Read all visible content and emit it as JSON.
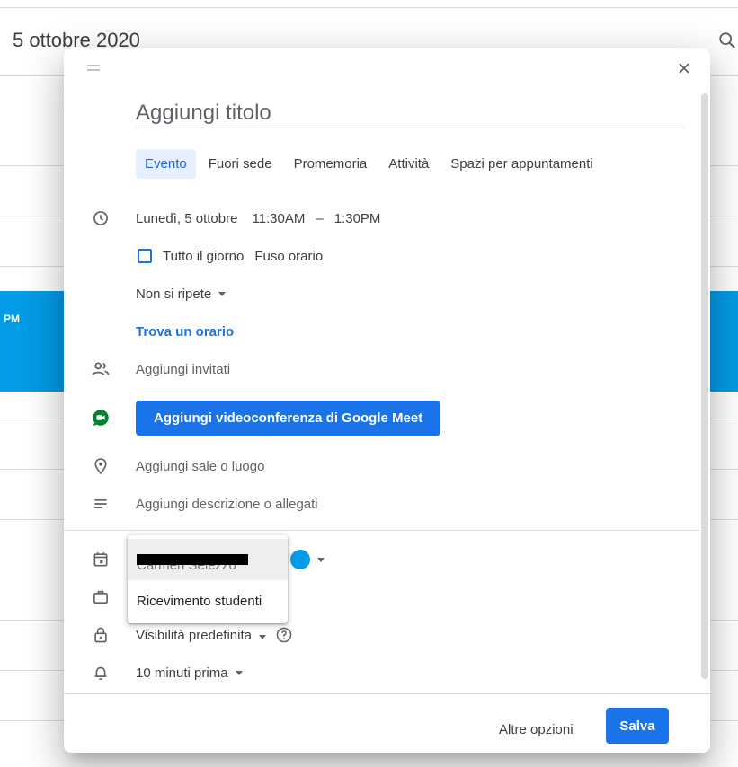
{
  "background": {
    "date_title": "5 ottobre 2020",
    "event_fragment": "PM"
  },
  "dialog": {
    "title_placeholder": "Aggiungi titolo",
    "tabs": [
      {
        "label": "Evento",
        "active": true
      },
      {
        "label": "Fuori sede",
        "active": false
      },
      {
        "label": "Promemoria",
        "active": false
      },
      {
        "label": "Attività",
        "active": false
      },
      {
        "label": "Spazi per appuntamenti",
        "active": false
      }
    ],
    "datetime": {
      "date": "Lunedì, 5 ottobre",
      "start": "11:30AM",
      "separator": "–",
      "end": "1:30PM"
    },
    "all_day_label": "Tutto il giorno",
    "timezone_label": "Fuso orario",
    "repeat_label": "Non si ripete",
    "find_time_label": "Trova un orario",
    "guests_placeholder": "Aggiungi invitati",
    "meet_button_label": "Aggiungi videoconferenza di Google Meet",
    "location_placeholder": "Aggiungi sale o luogo",
    "description_placeholder": "Aggiungi descrizione o allegati",
    "calendar_color": "#039be5",
    "visibility_label": "Visibilità predefinita",
    "notification_label": "10 minuti prima",
    "more_options_label": "Altre opzioni",
    "save_label": "Salva"
  },
  "dropdown": {
    "items": [
      {
        "label": "Carmen Selezzo",
        "redacted": true,
        "selected": true
      },
      {
        "label": "Ricevimento studenti",
        "redacted": false,
        "selected": false
      }
    ]
  },
  "colors": {
    "accent": "#1a73e8",
    "event_blue": "#039be5",
    "meet_green": "#00832d"
  }
}
